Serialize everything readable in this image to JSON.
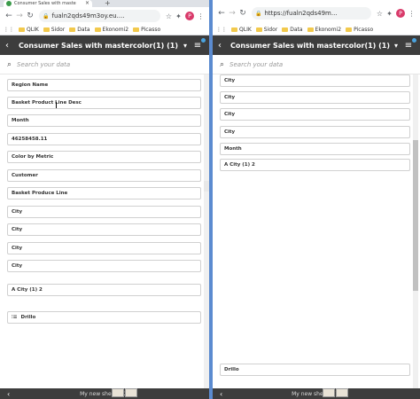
{
  "browser_left": {
    "tab_title": "Consumer Sales with maste",
    "tab_close": "×",
    "tab_new": "+",
    "url": "fualn2qds49m3oy.eu....",
    "avatar_letter": "P"
  },
  "browser_right": {
    "url": "https://fualn2qds49m...",
    "avatar_letter": "P"
  },
  "bookmarks_left": [
    "QLIK",
    "Sidor",
    "Data",
    "Ekonomi2",
    "Picasso"
  ],
  "bookmarks_right": [
    "QLIK",
    "Sidor",
    "Data",
    "Ekonomi2",
    "Picasso"
  ],
  "app": {
    "title": "Consumer Sales with mastercolor(1) (1)",
    "search_placeholder": "Search your data"
  },
  "left_items": [
    "Region Name",
    "Basket Product Line Desc",
    "Month",
    "46258458.11",
    "Color by Metric",
    "Customer",
    "Basket Produce Line",
    "City",
    "City",
    "City",
    "City",
    "A City (1) 2",
    "Drillo"
  ],
  "right_items": [
    "City",
    "City",
    "City",
    "City",
    "Month",
    "A City (1) 2",
    "Drillo"
  ],
  "footer_left": "My new sheet (72)",
  "footer_right": "My new sheet (72)"
}
